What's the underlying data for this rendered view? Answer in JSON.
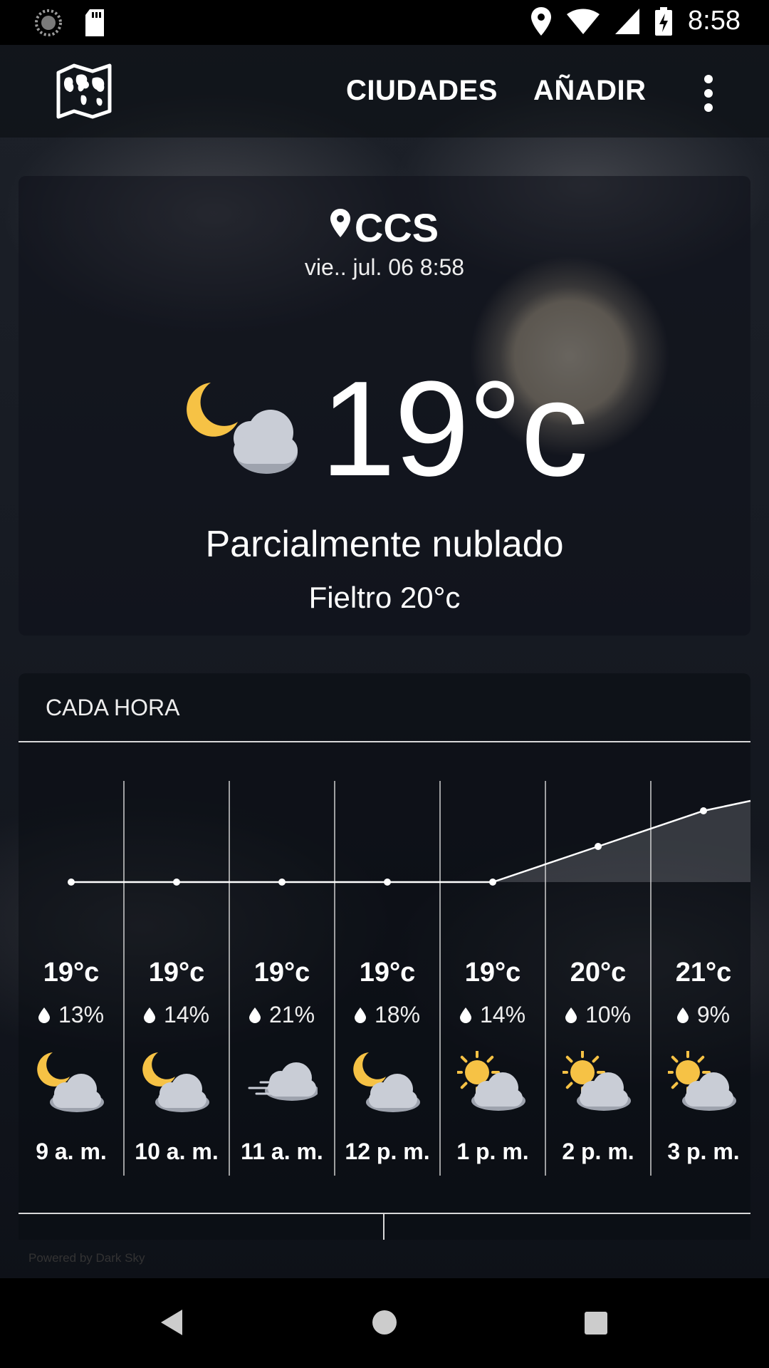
{
  "status_bar": {
    "time": "8:58"
  },
  "app_bar": {
    "cities_label": "CIUDADES",
    "add_label": "AÑADIR"
  },
  "current": {
    "city": "CCS",
    "datetime": "vie.. jul. 06 8:58",
    "temperature": "19°c",
    "summary": "Parcialmente nublado",
    "feels_like": "Fieltro 20°c"
  },
  "hourly": {
    "title": "CADA HORA",
    "items": [
      {
        "temp": "19°c",
        "precip": "13%",
        "time": "9 a. m.",
        "icon": "partly-cloudy-night-icon"
      },
      {
        "temp": "19°c",
        "precip": "14%",
        "time": "10 a. m.",
        "icon": "partly-cloudy-night-icon"
      },
      {
        "temp": "19°c",
        "precip": "21%",
        "time": "11 a. m.",
        "icon": "wind-cloud-icon"
      },
      {
        "temp": "19°c",
        "precip": "18%",
        "time": "12 p. m.",
        "icon": "partly-cloudy-night-icon"
      },
      {
        "temp": "19°c",
        "precip": "14%",
        "time": "1 p. m.",
        "icon": "partly-cloudy-day-icon"
      },
      {
        "temp": "20°c",
        "precip": "10%",
        "time": "2 p. m.",
        "icon": "partly-cloudy-day-icon"
      },
      {
        "temp": "21°c",
        "precip": "9%",
        "time": "3 p. m.",
        "icon": "partly-cloudy-day-icon"
      }
    ]
  },
  "chart_data": {
    "type": "line",
    "x": [
      "9 a. m.",
      "10 a. m.",
      "11 a. m.",
      "12 p. m.",
      "1 p. m.",
      "2 p. m.",
      "3 p. m."
    ],
    "series": [
      {
        "values": [
          19,
          19,
          19,
          19,
          19,
          20,
          21
        ]
      }
    ]
  },
  "footer": {
    "powered": "Powered by Dark Sky"
  },
  "colors": {
    "moon": "#F6C245",
    "sun": "#F6C245",
    "cloud": "#C9CDD6"
  }
}
